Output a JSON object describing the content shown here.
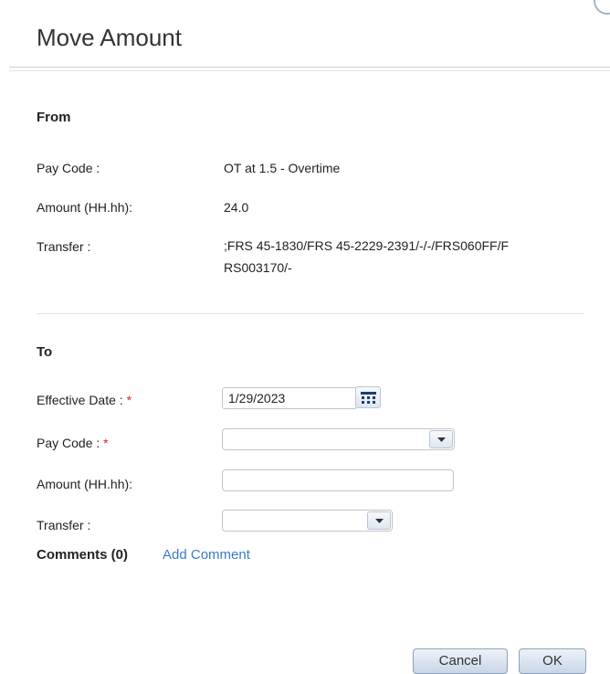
{
  "dialog": {
    "title": "Move Amount"
  },
  "from": {
    "heading": "From",
    "pay_code_label": "Pay Code :",
    "pay_code_value": "OT at 1.5 - Overtime",
    "amount_label": "Amount (HH.hh):",
    "amount_value": "24.0",
    "transfer_label": "Transfer :",
    "transfer_value_line1": ";FRS 45-1830/FRS 45-2229-2391/-/-/FRS060FF/F",
    "transfer_value_line2": "RS003170/-"
  },
  "to": {
    "heading": "To",
    "effective_date_label": "Effective Date :",
    "effective_date_value": "1/29/2023",
    "pay_code_label": "Pay Code :",
    "pay_code_value": "",
    "amount_label": "Amount (HH.hh):",
    "amount_value": "",
    "transfer_label": "Transfer :",
    "transfer_value": "",
    "required_marker": "*"
  },
  "comments": {
    "label": "Comments (0)",
    "add_label": "Add Comment"
  },
  "buttons": {
    "cancel": "Cancel",
    "ok": "OK"
  },
  "colors": {
    "link": "#3a7bc8",
    "required": "#dd2222",
    "button_border": "#8da2bd"
  },
  "icons": {
    "calendar": "calendar-icon",
    "dropdown": "chevron-down-icon"
  }
}
